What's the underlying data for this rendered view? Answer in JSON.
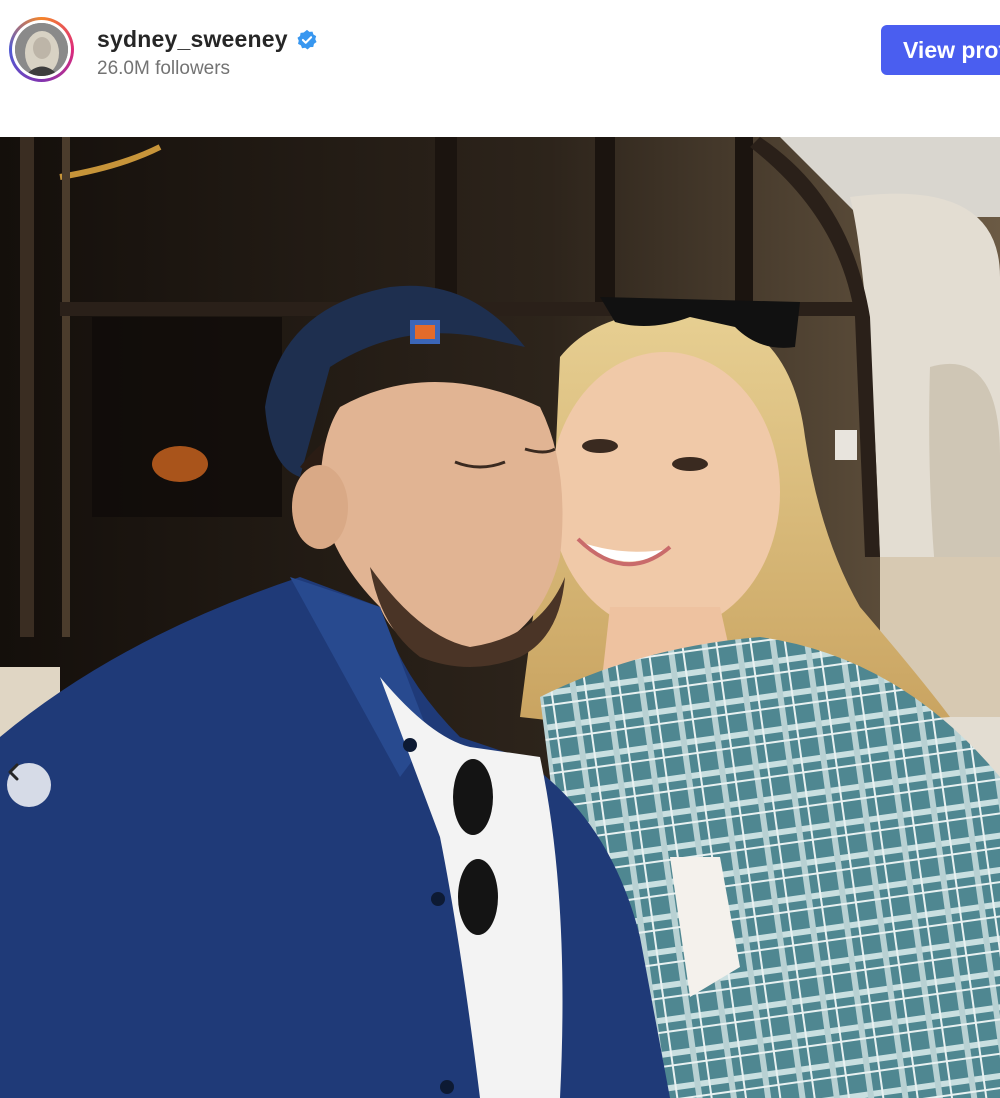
{
  "profile": {
    "username": "sydney_sweeney",
    "followers": "26.0M followers",
    "verified": true,
    "view_profile_label": "View profile",
    "accent_color": "#4a5ef0",
    "verified_color": "#3897f0"
  },
  "post": {
    "carousel_prev_icon": "chevron-left-icon"
  }
}
